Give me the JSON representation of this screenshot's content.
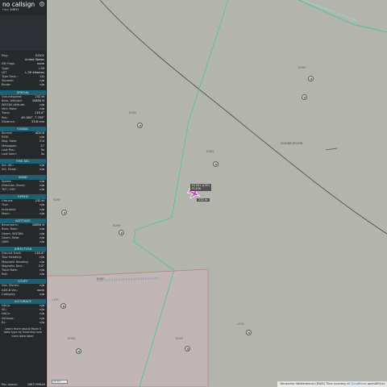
{
  "sidebar": {
    "callsign": "no callsign",
    "hex_label": "Hex:",
    "hex_value": "44ff1f",
    "reg_label": "Reg.:",
    "reg_value": "51201",
    "country": "United States",
    "db_flags_label": "DB Flags:",
    "db_flags_value": "none",
    "type_label": "Type:",
    "type_value": "L39",
    "type_desc": "L-39 Albatros",
    "type_desc_prefix": "LET",
    "type_desc_label": "Type Desc.:",
    "type_desc_value": "L1J",
    "squawk_label": "Squawk:",
    "squawk_value": "n/a",
    "route_label": "Route:",
    "route_value": "n/a",
    "sections": {
      "spatial": "SPATIAL",
      "signal": "SIGNAL",
      "fms_sel": "FMS SEL",
      "wind": "WIND",
      "speed": "SPEED",
      "altitude": "ALTITUDE",
      "direction": "DIRECTION",
      "stuff": "STUFF",
      "accuracy": "ACCURACY"
    },
    "spatial": [
      {
        "label": "Groundspeed:",
        "value": "232 kt"
      },
      {
        "label": "Baro. Altitude:",
        "value": "10850 ft"
      },
      {
        "label": "WGS84 altitude:",
        "value": "n/a"
      },
      {
        "label": "Vert. Rate:",
        "value": "n/a"
      },
      {
        "label": "Track:",
        "value": "116.4°"
      },
      {
        "label": "Pos.:",
        "value": "49.160°, 7.763°"
      },
      {
        "label": "Distance:",
        "value": "53.8 nmi"
      }
    ],
    "signal": [
      {
        "label": "Source:",
        "value": "ADS-B"
      },
      {
        "label": "RSSI:",
        "value": "n/a"
      },
      {
        "label": "Msg. Rate:",
        "value": "0.0"
      },
      {
        "label": "Messages:",
        "value": "27"
      },
      {
        "label": "Last Pos.:",
        "value": "5s"
      },
      {
        "label": "Last Seen:",
        "value": "5s"
      }
    ],
    "fms_sel": [
      {
        "label": "Sel. Alt.:",
        "value": "n/a"
      },
      {
        "label": "Sel. Head.:",
        "value": "n/a"
      }
    ],
    "wind": [
      {
        "label": "Speed:",
        "value": "n/a"
      },
      {
        "label": "Direction (from):",
        "value": "n/a"
      },
      {
        "label": "TAT / OAT:",
        "value": "n/a"
      }
    ],
    "speed": [
      {
        "label": "Ground:",
        "value": "232 kt"
      },
      {
        "label": "True:",
        "value": "n/a"
      },
      {
        "label": "Indicated:",
        "value": "n/a"
      },
      {
        "label": "Mach:",
        "value": "n/a"
      }
    ],
    "altitude": [
      {
        "label": "Barometric:",
        "value": "10850 ft"
      },
      {
        "label": "Baro. Rate:",
        "value": "n/a"
      },
      {
        "label": "Geom. WGS84:",
        "value": "n/a"
      },
      {
        "label": "Geom. Rate:",
        "value": "n/a"
      },
      {
        "label": "QNH:",
        "value": "n/a"
      }
    ],
    "direction": [
      {
        "label": "Ground Track:",
        "value": "116.4°"
      },
      {
        "label": "True Heading:",
        "value": "n/a"
      },
      {
        "label": "Magnetic Heading:",
        "value": "n/a"
      },
      {
        "label": "Magnetic Decl.:",
        "value": "3.2°"
      },
      {
        "label": "Track Rate:",
        "value": "n/a"
      },
      {
        "label": "Roll:",
        "value": "n/a"
      }
    ],
    "stuff": [
      {
        "label": "Nav. Modes:",
        "value": "n/a"
      },
      {
        "label": "ADS-B Ver.:",
        "value": "none"
      },
      {
        "label": "Category:",
        "value": "n/a"
      }
    ],
    "accuracy": [
      {
        "label": "NACp:",
        "value": "n/a"
      },
      {
        "label": "SIL:",
        "value": "n/a"
      },
      {
        "label": "NACv:",
        "value": "n/a"
      },
      {
        "label": "NICbaro:",
        "value": "n/a"
      },
      {
        "label": "Rc:",
        "value": "n/a"
      }
    ],
    "help_text": "Learn more about Mode S data type by hovering over each data label.",
    "footer_label": "Pos. epoch:",
    "footer_value": "1687799849"
  },
  "map": {
    "aircraft_label_1": "51201 (L39)",
    "aircraft_label_2": "FL108",
    "aircraft_label_3": "232 kt",
    "scale_text": "10 km",
    "attribution_prefix": "Deutscher Wetterdienst (DWD) Tiles courtesy of",
    "attribution_link1": "CloudBurst",
    "attribution_mid": "openAIP.net",
    "labels": {
      "l1": "EDRZ",
      "l2": "EDRV",
      "l3": "EDRS",
      "l4": "ZWEIBRUECKEN",
      "l5": "EDRP",
      "l6": "EDRB",
      "l7": "LFST",
      "l8": "EDRA",
      "l9": "EDSP",
      "l10": "LFGE",
      "l11": "EDRY"
    },
    "colors": {
      "border": "#55bfa5",
      "region_fill": "#c7b8b8",
      "region_stroke": "#b08a8a",
      "arc": "#3d4247",
      "aircraft": "#e23cc8"
    }
  }
}
